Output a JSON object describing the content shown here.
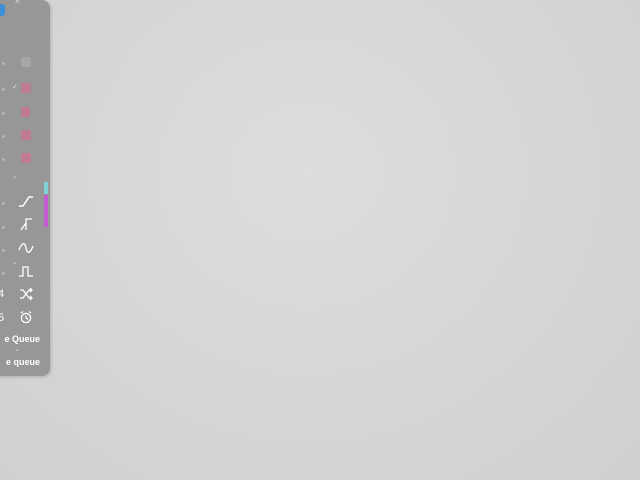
{
  "sidebar": {
    "numbers": [
      "4",
      "5"
    ],
    "queue_labels": [
      "e Queue",
      "e queue"
    ],
    "toggle_icon": "✓",
    "icons": [
      "ramp-icon",
      "step-icon",
      "sine-icon",
      "pulse-icon",
      "shuffle-icon",
      "alarm-icon"
    ],
    "colors": {
      "panel": "#979797",
      "accent_blue": "#3f8fd6",
      "accent_pink": "#c07a92",
      "accent_cyan": "#7fd0d6",
      "accent_magenta": "#c45bd0"
    }
  }
}
